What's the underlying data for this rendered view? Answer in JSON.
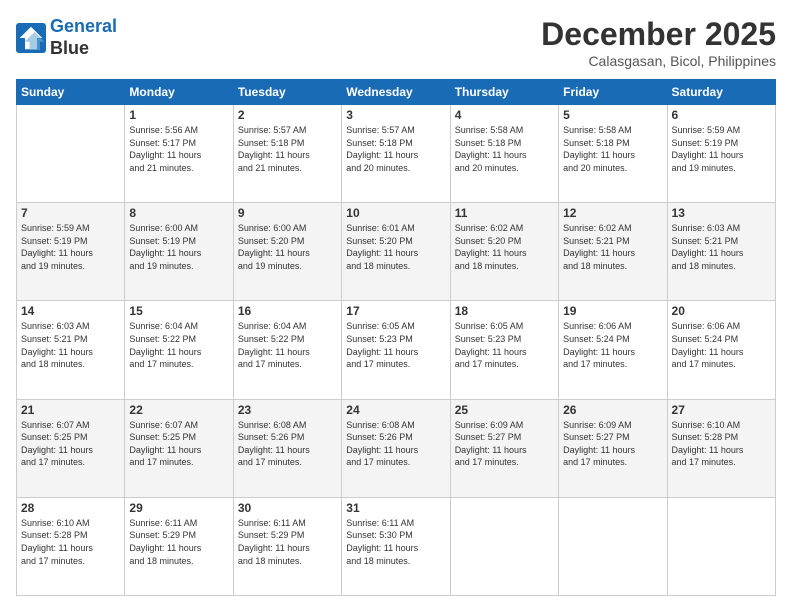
{
  "header": {
    "logo_line1": "General",
    "logo_line2": "Blue",
    "month_year": "December 2025",
    "location": "Calasgasan, Bicol, Philippines"
  },
  "columns": [
    "Sunday",
    "Monday",
    "Tuesday",
    "Wednesday",
    "Thursday",
    "Friday",
    "Saturday"
  ],
  "weeks": [
    [
      {
        "day": "",
        "info": ""
      },
      {
        "day": "1",
        "info": "Sunrise: 5:56 AM\nSunset: 5:17 PM\nDaylight: 11 hours\nand 21 minutes."
      },
      {
        "day": "2",
        "info": "Sunrise: 5:57 AM\nSunset: 5:18 PM\nDaylight: 11 hours\nand 21 minutes."
      },
      {
        "day": "3",
        "info": "Sunrise: 5:57 AM\nSunset: 5:18 PM\nDaylight: 11 hours\nand 20 minutes."
      },
      {
        "day": "4",
        "info": "Sunrise: 5:58 AM\nSunset: 5:18 PM\nDaylight: 11 hours\nand 20 minutes."
      },
      {
        "day": "5",
        "info": "Sunrise: 5:58 AM\nSunset: 5:18 PM\nDaylight: 11 hours\nand 20 minutes."
      },
      {
        "day": "6",
        "info": "Sunrise: 5:59 AM\nSunset: 5:19 PM\nDaylight: 11 hours\nand 19 minutes."
      }
    ],
    [
      {
        "day": "7",
        "info": "Sunrise: 5:59 AM\nSunset: 5:19 PM\nDaylight: 11 hours\nand 19 minutes."
      },
      {
        "day": "8",
        "info": "Sunrise: 6:00 AM\nSunset: 5:19 PM\nDaylight: 11 hours\nand 19 minutes."
      },
      {
        "day": "9",
        "info": "Sunrise: 6:00 AM\nSunset: 5:20 PM\nDaylight: 11 hours\nand 19 minutes."
      },
      {
        "day": "10",
        "info": "Sunrise: 6:01 AM\nSunset: 5:20 PM\nDaylight: 11 hours\nand 18 minutes."
      },
      {
        "day": "11",
        "info": "Sunrise: 6:02 AM\nSunset: 5:20 PM\nDaylight: 11 hours\nand 18 minutes."
      },
      {
        "day": "12",
        "info": "Sunrise: 6:02 AM\nSunset: 5:21 PM\nDaylight: 11 hours\nand 18 minutes."
      },
      {
        "day": "13",
        "info": "Sunrise: 6:03 AM\nSunset: 5:21 PM\nDaylight: 11 hours\nand 18 minutes."
      }
    ],
    [
      {
        "day": "14",
        "info": "Sunrise: 6:03 AM\nSunset: 5:21 PM\nDaylight: 11 hours\nand 18 minutes."
      },
      {
        "day": "15",
        "info": "Sunrise: 6:04 AM\nSunset: 5:22 PM\nDaylight: 11 hours\nand 17 minutes."
      },
      {
        "day": "16",
        "info": "Sunrise: 6:04 AM\nSunset: 5:22 PM\nDaylight: 11 hours\nand 17 minutes."
      },
      {
        "day": "17",
        "info": "Sunrise: 6:05 AM\nSunset: 5:23 PM\nDaylight: 11 hours\nand 17 minutes."
      },
      {
        "day": "18",
        "info": "Sunrise: 6:05 AM\nSunset: 5:23 PM\nDaylight: 11 hours\nand 17 minutes."
      },
      {
        "day": "19",
        "info": "Sunrise: 6:06 AM\nSunset: 5:24 PM\nDaylight: 11 hours\nand 17 minutes."
      },
      {
        "day": "20",
        "info": "Sunrise: 6:06 AM\nSunset: 5:24 PM\nDaylight: 11 hours\nand 17 minutes."
      }
    ],
    [
      {
        "day": "21",
        "info": "Sunrise: 6:07 AM\nSunset: 5:25 PM\nDaylight: 11 hours\nand 17 minutes."
      },
      {
        "day": "22",
        "info": "Sunrise: 6:07 AM\nSunset: 5:25 PM\nDaylight: 11 hours\nand 17 minutes."
      },
      {
        "day": "23",
        "info": "Sunrise: 6:08 AM\nSunset: 5:26 PM\nDaylight: 11 hours\nand 17 minutes."
      },
      {
        "day": "24",
        "info": "Sunrise: 6:08 AM\nSunset: 5:26 PM\nDaylight: 11 hours\nand 17 minutes."
      },
      {
        "day": "25",
        "info": "Sunrise: 6:09 AM\nSunset: 5:27 PM\nDaylight: 11 hours\nand 17 minutes."
      },
      {
        "day": "26",
        "info": "Sunrise: 6:09 AM\nSunset: 5:27 PM\nDaylight: 11 hours\nand 17 minutes."
      },
      {
        "day": "27",
        "info": "Sunrise: 6:10 AM\nSunset: 5:28 PM\nDaylight: 11 hours\nand 17 minutes."
      }
    ],
    [
      {
        "day": "28",
        "info": "Sunrise: 6:10 AM\nSunset: 5:28 PM\nDaylight: 11 hours\nand 17 minutes."
      },
      {
        "day": "29",
        "info": "Sunrise: 6:11 AM\nSunset: 5:29 PM\nDaylight: 11 hours\nand 18 minutes."
      },
      {
        "day": "30",
        "info": "Sunrise: 6:11 AM\nSunset: 5:29 PM\nDaylight: 11 hours\nand 18 minutes."
      },
      {
        "day": "31",
        "info": "Sunrise: 6:11 AM\nSunset: 5:30 PM\nDaylight: 11 hours\nand 18 minutes."
      },
      {
        "day": "",
        "info": ""
      },
      {
        "day": "",
        "info": ""
      },
      {
        "day": "",
        "info": ""
      }
    ]
  ]
}
